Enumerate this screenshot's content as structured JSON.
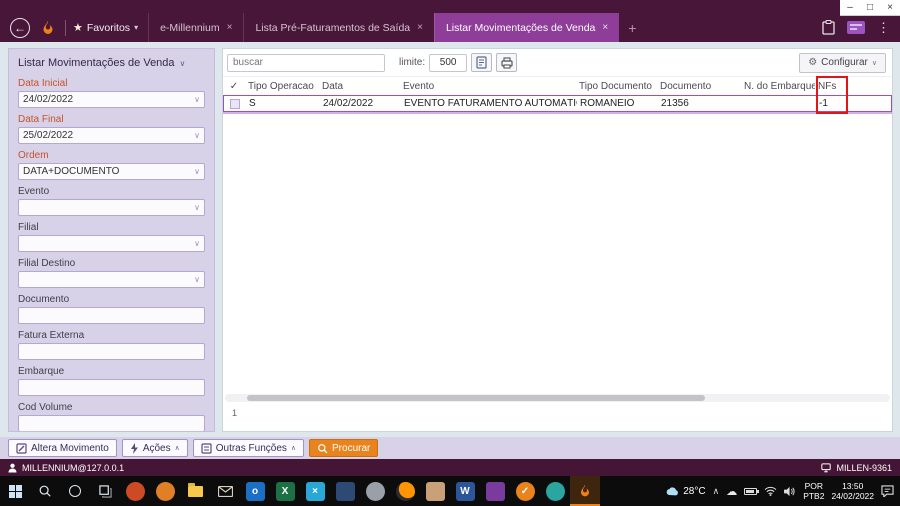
{
  "colors": {
    "header_bg": "#471638",
    "active_tab_purple": "#8e3d99",
    "sidebar_lavender": "#d8d2e8",
    "accent_orange": "#e8831d",
    "selection_purple": "#9b4fc4",
    "annotation_red": "#e31414",
    "field_label_red": "#c4532c"
  },
  "icons": {
    "minimize": "–",
    "maximize": "□",
    "close_x": "×",
    "back": "←",
    "star": "★",
    "caret_small": "▾",
    "plus": "+",
    "kebab": "⋮",
    "chevron_down": "∨",
    "chevron_up": "∧",
    "check": "✓",
    "gear": "⚙",
    "cloud": "☁"
  },
  "header": {
    "favorites_label": "Favoritos",
    "tabs": [
      {
        "label": "e-Millennium"
      },
      {
        "label": "Lista Pré-Faturamentos de Saída"
      },
      {
        "label": "Listar Movimentações de Venda"
      }
    ]
  },
  "sidebar": {
    "title": "Listar Movimentações de Venda",
    "fields": [
      {
        "label": "Data Inicial",
        "value": "24/02/2022"
      },
      {
        "label": "Data Final",
        "value": "25/02/2022"
      },
      {
        "label": "Ordem",
        "value": "DATA+DOCUMENTO"
      },
      {
        "label": "Evento",
        "value": ""
      },
      {
        "label": "Filial",
        "value": ""
      },
      {
        "label": "Filial Destino",
        "value": ""
      },
      {
        "label": "Documento",
        "value": ""
      },
      {
        "label": "Fatura Externa",
        "value": ""
      },
      {
        "label": "Embarque",
        "value": ""
      },
      {
        "label": "Cod Volume",
        "value": ""
      }
    ]
  },
  "toolbar": {
    "search_placeholder": "buscar",
    "limit_label": "limite:",
    "limit_value": "500",
    "configure_label": "Configurar"
  },
  "table": {
    "columns": [
      "Tipo Operacao",
      "Data",
      "Evento",
      "Tipo Documento",
      "Documento",
      "N. do Embarque",
      "NFs"
    ],
    "rows": [
      [
        "S",
        "24/02/2022",
        "EVENTO FATURAMENTO AUTOMÁTICO",
        "ROMANEIO",
        "21356",
        "",
        "-1"
      ]
    ],
    "page_indicator": "1"
  },
  "actions": {
    "altera_movimento": "Altera Movimento",
    "acoes": "Ações",
    "outras_funcoes": "Outras Funções",
    "procurar": "Procurar"
  },
  "statusbar": {
    "connection": "MILLENNIUM@127.0.0.1",
    "machine": "MILLEN-9361"
  },
  "taskbar": {
    "temperature": "28°C",
    "lang_line1": "POR",
    "lang_line2": "PTB2",
    "time": "13:50",
    "date": "24/02/2022",
    "app_glyphs": {
      "outlook": "o",
      "excel": "X",
      "x2": "×",
      "word": "W",
      "check": "✓"
    }
  }
}
